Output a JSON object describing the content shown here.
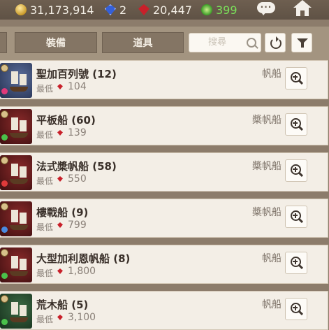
{
  "currency": {
    "gold": "31,173,914",
    "diamond": "2",
    "ruby": "20,447",
    "guild_points": "399"
  },
  "tabs": [
    "",
    "裝備",
    "道具"
  ],
  "search": {
    "placeholder": "搜尋"
  },
  "price_label": "最低",
  "items": [
    {
      "name": "聖加百列號 (12)",
      "price": "104",
      "type": "帆船",
      "theme": "blue",
      "gem_color": "#e03a7a"
    },
    {
      "name": "平板船 (60)",
      "price": "139",
      "type": "槳帆船",
      "theme": "red",
      "gem_color": "#4ac04a"
    },
    {
      "name": "法式槳帆船 (58)",
      "price": "550",
      "type": "槳帆船",
      "theme": "red",
      "gem_color": "#e03a3a"
    },
    {
      "name": "樓戰船 (9)",
      "price": "799",
      "type": "槳帆船",
      "theme": "red",
      "gem_color": "#4a8ae0"
    },
    {
      "name": "大型加利恩帆船 (8)",
      "price": "1,800",
      "type": "帆船",
      "theme": "red",
      "gem_color": "#4ac04a"
    },
    {
      "name": "荒木船 (5)",
      "price": "3,100",
      "type": "帆船",
      "theme": "green",
      "gem_color": "#4ac04a"
    }
  ],
  "colors": {
    "accent_ruby": "#c8202a",
    "guild_green": "#7be05a"
  }
}
